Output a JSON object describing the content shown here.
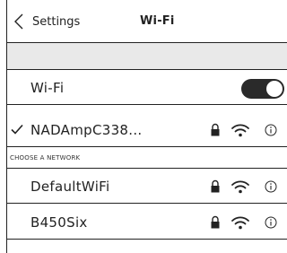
{
  "navbar": {
    "back_label": "Settings",
    "title": "Wi-Fi",
    "back_icon": "chevron-left-icon"
  },
  "wifi_toggle": {
    "label": "Wi-Fi",
    "enabled": true
  },
  "connected_network": {
    "name": "NADAmpC338...",
    "connected": true,
    "secured": true,
    "icons": [
      "checkmark-icon",
      "lock-icon",
      "wifi-icon",
      "info-icon"
    ]
  },
  "section": {
    "header": "CHOOSE A NETWORK"
  },
  "networks": [
    {
      "name": "DefaultWiFi",
      "secured": true
    },
    {
      "name": "B450Six",
      "secured": true
    }
  ],
  "colors": {
    "text": "#222222",
    "toggle_on": "#2a2a2a",
    "group_separator": "#e9e9e9"
  }
}
